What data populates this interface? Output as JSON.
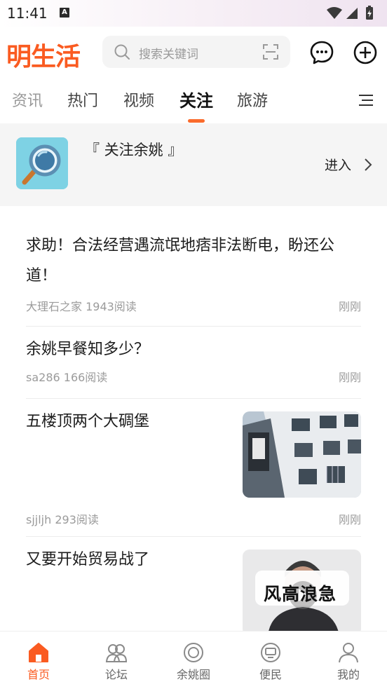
{
  "status_bar": {
    "time": "11:41",
    "notification_badge": "A"
  },
  "header": {
    "logo": "明生活",
    "search_placeholder": "搜索关键词",
    "brand_color": "#fa5b21"
  },
  "tabs": [
    {
      "label": "资讯"
    },
    {
      "label": "热门"
    },
    {
      "label": "视频"
    },
    {
      "label": "关注",
      "active": true
    },
    {
      "label": "旅游"
    }
  ],
  "follow_card": {
    "title": "『 关注余姚 』",
    "enter_label": "进入"
  },
  "feed": [
    {
      "title": "求助！合法经营遇流氓地痞非法断电，盼还公道！",
      "meta": "大理石之家 1943阅读",
      "time": "刚刚"
    },
    {
      "title": "余姚早餐知多少？",
      "meta": "sa286 166阅读",
      "time": "刚刚"
    },
    {
      "title": "五楼顶两个大碉堡",
      "meta": "sjjljh 293阅读",
      "time": "刚刚"
    },
    {
      "title": "又要开始贸易战了",
      "video_caption": "风高浪急"
    }
  ],
  "bottom_nav": [
    {
      "label": "首页",
      "icon": "home-icon",
      "active": true
    },
    {
      "label": "论坛",
      "icon": "forum-icon"
    },
    {
      "label": "余姚圈",
      "icon": "circle-icon"
    },
    {
      "label": "便民",
      "icon": "service-icon"
    },
    {
      "label": "我的",
      "icon": "profile-icon"
    }
  ]
}
